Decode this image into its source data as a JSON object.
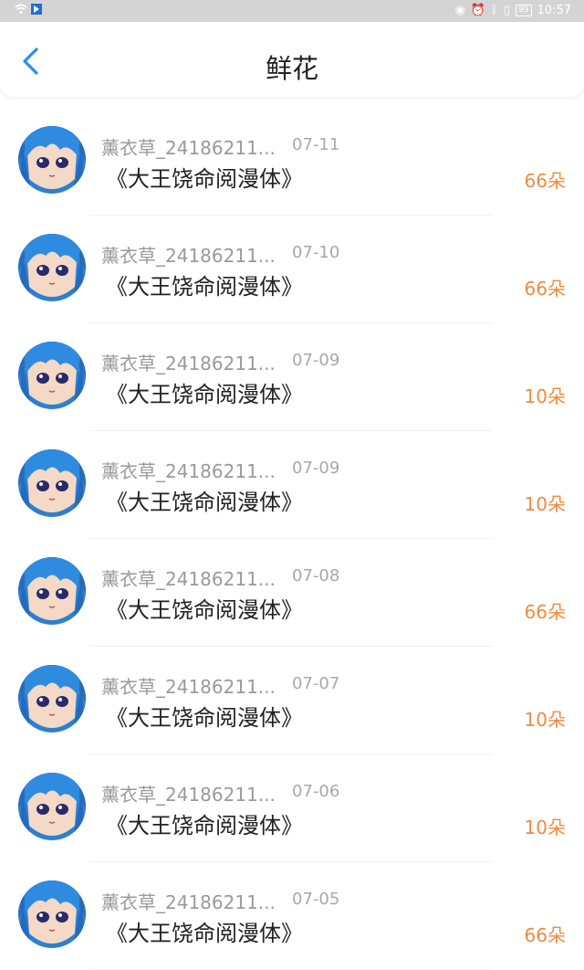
{
  "status_bar": {
    "time": "10:57",
    "battery": "99"
  },
  "header": {
    "title": "鲜花"
  },
  "colors": {
    "accent_blue": "#2d8cf0",
    "flower_orange": "#ef8a3f",
    "status_bar_bg": "#d4d4d4"
  },
  "records": [
    {
      "user": "薰衣草_24186211...",
      "date": "07-11",
      "book": "《大王饶命阅漫体》",
      "flowers": "66朵"
    },
    {
      "user": "薰衣草_24186211...",
      "date": "07-10",
      "book": "《大王饶命阅漫体》",
      "flowers": "66朵"
    },
    {
      "user": "薰衣草_24186211...",
      "date": "07-09",
      "book": "《大王饶命阅漫体》",
      "flowers": "10朵"
    },
    {
      "user": "薰衣草_24186211...",
      "date": "07-09",
      "book": "《大王饶命阅漫体》",
      "flowers": "10朵"
    },
    {
      "user": "薰衣草_24186211...",
      "date": "07-08",
      "book": "《大王饶命阅漫体》",
      "flowers": "66朵"
    },
    {
      "user": "薰衣草_24186211...",
      "date": "07-07",
      "book": "《大王饶命阅漫体》",
      "flowers": "10朵"
    },
    {
      "user": "薰衣草_24186211...",
      "date": "07-06",
      "book": "《大王饶命阅漫体》",
      "flowers": "10朵"
    },
    {
      "user": "薰衣草_24186211...",
      "date": "07-05",
      "book": "《大王饶命阅漫体》",
      "flowers": "66朵"
    }
  ]
}
